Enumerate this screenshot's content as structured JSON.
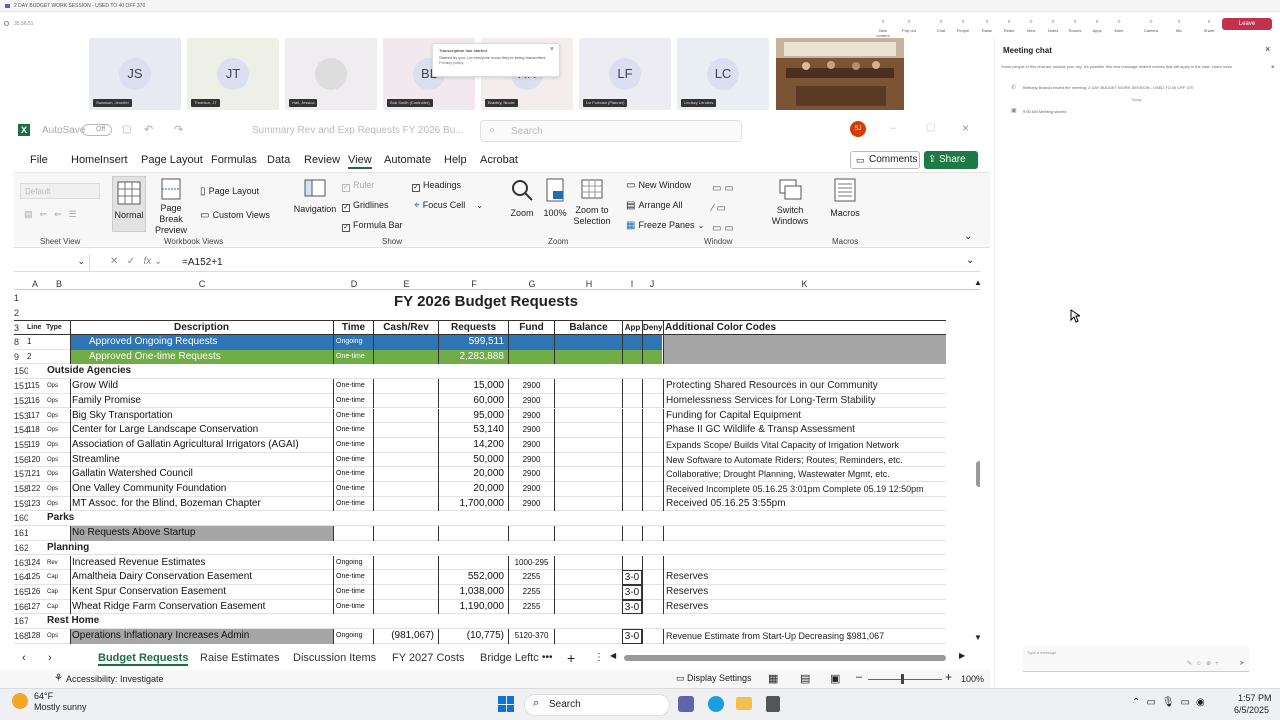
{
  "teams": {
    "top_title": "2 DAY BUDGET WORK SESSION - USED TO 40 OFF 370",
    "timer": "35:56:51",
    "toolbar": [
      "New content",
      "Pop out",
      "Chat",
      "People",
      "Raise",
      "React",
      "View",
      "Notes",
      "Rooms",
      "Apps",
      "More",
      "Camera",
      "Mic",
      "Share"
    ],
    "leave_label": "Leave",
    "participants": [
      {
        "initials": "JS",
        "name": "Swanson, Jennifer"
      },
      {
        "initials": "JT",
        "name": "Thornton, JT"
      },
      {
        "initials": "",
        "name": "Hall, Jessica"
      },
      {
        "initials": "BL",
        "name": "Bob Smith (Controller)"
      },
      {
        "initials": "HH",
        "name": "Bradley, Nicole"
      },
      {
        "initials": "LF",
        "name": "Liz Forbush (Planner)"
      },
      {
        "initials": "LC",
        "name": "Lindsey Lenders"
      }
    ],
    "toast_title": "Transcription has started",
    "toast_body": "Started by you. Let everyone know they're being transcribed.",
    "toast_link": "Privacy policy"
  },
  "chat": {
    "title": "Meeting chat",
    "notice": "Some people in this chat are outside your org. It's possible this new message related notices that will apply in the chat. Learn more",
    "entry1": "Bethany Brando ended the meeting: 2 DAY BUDGET WORK SESSION - USED TO 40 OFF 370",
    "today": "Today",
    "entry2": "9:50 AM  Meeting started",
    "input_placeholder": "Type a message"
  },
  "excel": {
    "autosave": "AutoSave",
    "autosave_state": "Off",
    "filename": "Summary Rev and Exp Requests FY 2026 Bu...",
    "search_placeholder": "Search",
    "user_initials": "SJ",
    "menu": [
      "File",
      "Home",
      "Insert",
      "Page Layout",
      "Formulas",
      "Data",
      "Review",
      "View",
      "Automate",
      "Help",
      "Acrobat"
    ],
    "comments": "Comments",
    "share": "Share",
    "ribbon": {
      "default": "Default",
      "normal": "Normal",
      "page_break": "Page Break Preview",
      "page_layout": "Page Layout",
      "custom_views": "Custom Views",
      "navigation": "Navigation",
      "ruler": "Ruler",
      "gridlines": "Gridlines",
      "formula_bar": "Formula Bar",
      "headings": "Headings",
      "focus_cell": "Focus Cell",
      "zoom": "Zoom",
      "zoom100": "100%",
      "zoom_sel": "Zoom to Selection",
      "new_window": "New Window",
      "arrange_all": "Arrange All",
      "freeze": "Freeze Panes",
      "switch": "Switch Windows",
      "macros": "Macros",
      "g_sheet": "Sheet View",
      "g_wb": "Workbook Views",
      "g_show": "Show",
      "g_zoom": "Zoom",
      "g_window": "Window",
      "g_macros": "Macros"
    },
    "formula": "=A152+1",
    "columns": [
      "A",
      "B",
      "C",
      "D",
      "E",
      "F",
      "G",
      "H",
      "I",
      "J",
      "K"
    ],
    "title": "FY 2026 Budget Requests",
    "headers": {
      "line": "Line",
      "type": "Type",
      "desc": "Description",
      "time": "Time",
      "cash": "Cash/Rev",
      "req": "Requests",
      "fund": "Fund",
      "bal": "Balance",
      "app": "App",
      "deny": "Deny",
      "add": "Additional Color Codes"
    },
    "rows": [
      {
        "rn": "8",
        "a": "1",
        "b": "",
        "c": "Approved Ongoing Requests",
        "d": "Ongoing",
        "e": "",
        "f": "599,511",
        "g": "",
        "i": "",
        "k": "",
        "style": "blue"
      },
      {
        "rn": "9",
        "a": "2",
        "b": "",
        "c": "Approved One-time Requests",
        "d": "One-time",
        "e": "",
        "f": "2,283,888",
        "g": "",
        "i": "",
        "k": "",
        "style": "green"
      },
      {
        "rn": "150",
        "a": "",
        "b": "Outside Agencies",
        "c": "",
        "d": "",
        "e": "",
        "f": "",
        "g": "",
        "i": "",
        "k": "",
        "style": "sect"
      },
      {
        "rn": "151",
        "a": "115",
        "b": "Ops",
        "c": "Grow Wild",
        "d": "One-time",
        "e": "",
        "f": "15,000",
        "g": "2900",
        "i": "",
        "k": "Protecting Shared Resources in our Community"
      },
      {
        "rn": "152",
        "a": "116",
        "b": "Ops",
        "c": "Family Promise",
        "d": "One-time",
        "e": "",
        "f": "60,000",
        "g": "2900",
        "i": "",
        "k": "Homelessness Services for Long-Term Stability"
      },
      {
        "rn": "153",
        "a": "117",
        "b": "Ops",
        "c": "Big Sky Transportation",
        "d": "One-time",
        "e": "",
        "f": "95,000",
        "g": "2900",
        "i": "",
        "k": "Funding for Capital Equipment"
      },
      {
        "rn": "154",
        "a": "118",
        "b": "Ops",
        "c": "Center for Large Landscape Conservation",
        "d": "One-time",
        "e": "",
        "f": "53,140",
        "g": "2900",
        "i": "",
        "k": "Phase II GC Wildlife  & Transp Assessment"
      },
      {
        "rn": "155",
        "a": "119",
        "b": "Ops",
        "c": "Association of Gallatin Agricultural Irrigators (AGAI)",
        "d": "One-time",
        "e": "",
        "f": "14,200",
        "g": "2900",
        "i": "",
        "k": "Expands Scope/ Builds Vital Capacity of Irrigation Network"
      },
      {
        "rn": "156",
        "a": "120",
        "b": "Ops",
        "c": "Streamline",
        "d": "One-time",
        "e": "",
        "f": "50,000",
        "g": "2900",
        "i": "",
        "k": "New Software to Automate Riders; Routes; Reminders, etc."
      },
      {
        "rn": "157",
        "a": "121",
        "b": "Ops",
        "c": "Gallatin Watershed Council",
        "d": "One-time",
        "e": "",
        "f": "20,000",
        "g": "2900",
        "i": "",
        "k": "Collaborative; Drought Planning, Wastewater Mgmt, etc."
      },
      {
        "rn": "158",
        "a": "122",
        "b": "Ops",
        "c": "One Valley Community Foundation",
        "d": "One-time",
        "e": "",
        "f": "20,000",
        "g": "2900",
        "i": "",
        "k": "Received Incomplete 05.16.25 3:01pm Complete 05.19 12:50pm"
      },
      {
        "rn": "159",
        "a": "123",
        "b": "Ops",
        "c": "MT Assoc. for the Blind, Bozeman Chapter",
        "d": "One-time",
        "e": "",
        "f": "1,700,000",
        "g": "2900",
        "i": "",
        "k": "Received 05.16.25 3:55pm"
      },
      {
        "rn": "160",
        "a": "",
        "b": "Parks",
        "c": "",
        "d": "",
        "e": "",
        "f": "",
        "g": "",
        "i": "",
        "k": "",
        "style": "sect"
      },
      {
        "rn": "161",
        "a": "",
        "b": "",
        "c": "No Requests Above Startup",
        "d": "",
        "e": "",
        "f": "",
        "g": "",
        "i": "",
        "k": "",
        "style": "grey"
      },
      {
        "rn": "162",
        "a": "",
        "b": "Planning",
        "c": "",
        "d": "",
        "e": "",
        "f": "",
        "g": "",
        "i": "",
        "k": "",
        "style": "sect"
      },
      {
        "rn": "163",
        "a": "124",
        "b": "Rev",
        "c": "Increased Revenue Estimates",
        "d": "Ongoing",
        "e": "",
        "f": "",
        "g": "1000-295",
        "i": "",
        "k": ""
      },
      {
        "rn": "164",
        "a": "125",
        "b": "Cap",
        "c": "Amaltheia Dairy Conservation Easement",
        "d": "One-time",
        "e": "",
        "f": "552,000",
        "g": "2255",
        "i": "3-0",
        "k": "Reserves"
      },
      {
        "rn": "165",
        "a": "126",
        "b": "Cap",
        "c": "Kent Spur Conservation Easement",
        "d": "One-time",
        "e": "",
        "f": "1,038,000",
        "g": "2255",
        "i": "3-0",
        "k": "Reserves"
      },
      {
        "rn": "166",
        "a": "127",
        "b": "Cap",
        "c": "Wheat Ridge Farm Conservation Easement",
        "d": "One-time",
        "e": "",
        "f": "1,190,000",
        "g": "2255",
        "i": "3-0",
        "k": "Reserves"
      },
      {
        "rn": "167",
        "a": "",
        "b": "Rest Home",
        "c": "",
        "d": "",
        "e": "",
        "f": "",
        "g": "",
        "i": "",
        "k": "",
        "style": "sect"
      },
      {
        "rn": "168",
        "a": "128",
        "b": "Ops",
        "c": "Operations Inflationary Increases Admin",
        "d": "Ongoing",
        "e": "(981,067)",
        "f": "(10,775)",
        "g": "5120-370",
        "i": "3-0",
        "k": "Revenue Estimate from Start-Up Decreasing $981,067",
        "style": "greyc"
      }
    ],
    "sheets": [
      "Budget Requests",
      "Raise Estimates",
      "Discussion Items",
      "FY 2027 Costs",
      "Bridge Leftc"
    ],
    "status_access": "Accessibility: Investigate",
    "display_settings": "Display Settings",
    "zoom_pct": "100%"
  },
  "taskbar": {
    "temp": "64°F",
    "weather": "Mostly sunny",
    "search": "Search",
    "time": "1:57 PM",
    "date": "6/5/2025"
  }
}
